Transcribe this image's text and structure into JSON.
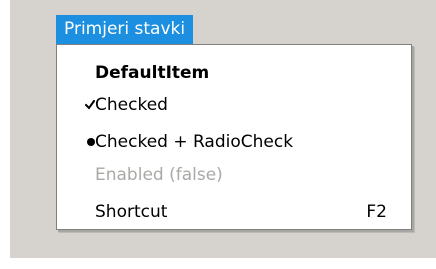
{
  "menu": {
    "header_label": "Primjeri stavki",
    "items": [
      {
        "label": "DefaultItem",
        "style": "bold",
        "mark": "none",
        "shortcut": ""
      },
      {
        "label": "Checked",
        "style": "normal",
        "mark": "checkmark-icon",
        "shortcut": ""
      },
      {
        "label": "Checked + RadioCheck",
        "style": "normal",
        "mark": "bullet-icon",
        "shortcut": ""
      },
      {
        "label": "Enabled (false)",
        "style": "disabled",
        "mark": "none",
        "shortcut": ""
      },
      {
        "label": "Shortcut",
        "style": "normal",
        "mark": "none",
        "shortcut": "F2"
      }
    ]
  },
  "colors": {
    "menu_header_bg": "#1c8fe0",
    "window_bg": "#d6d3ce",
    "disabled_text": "#aaa9a6"
  }
}
